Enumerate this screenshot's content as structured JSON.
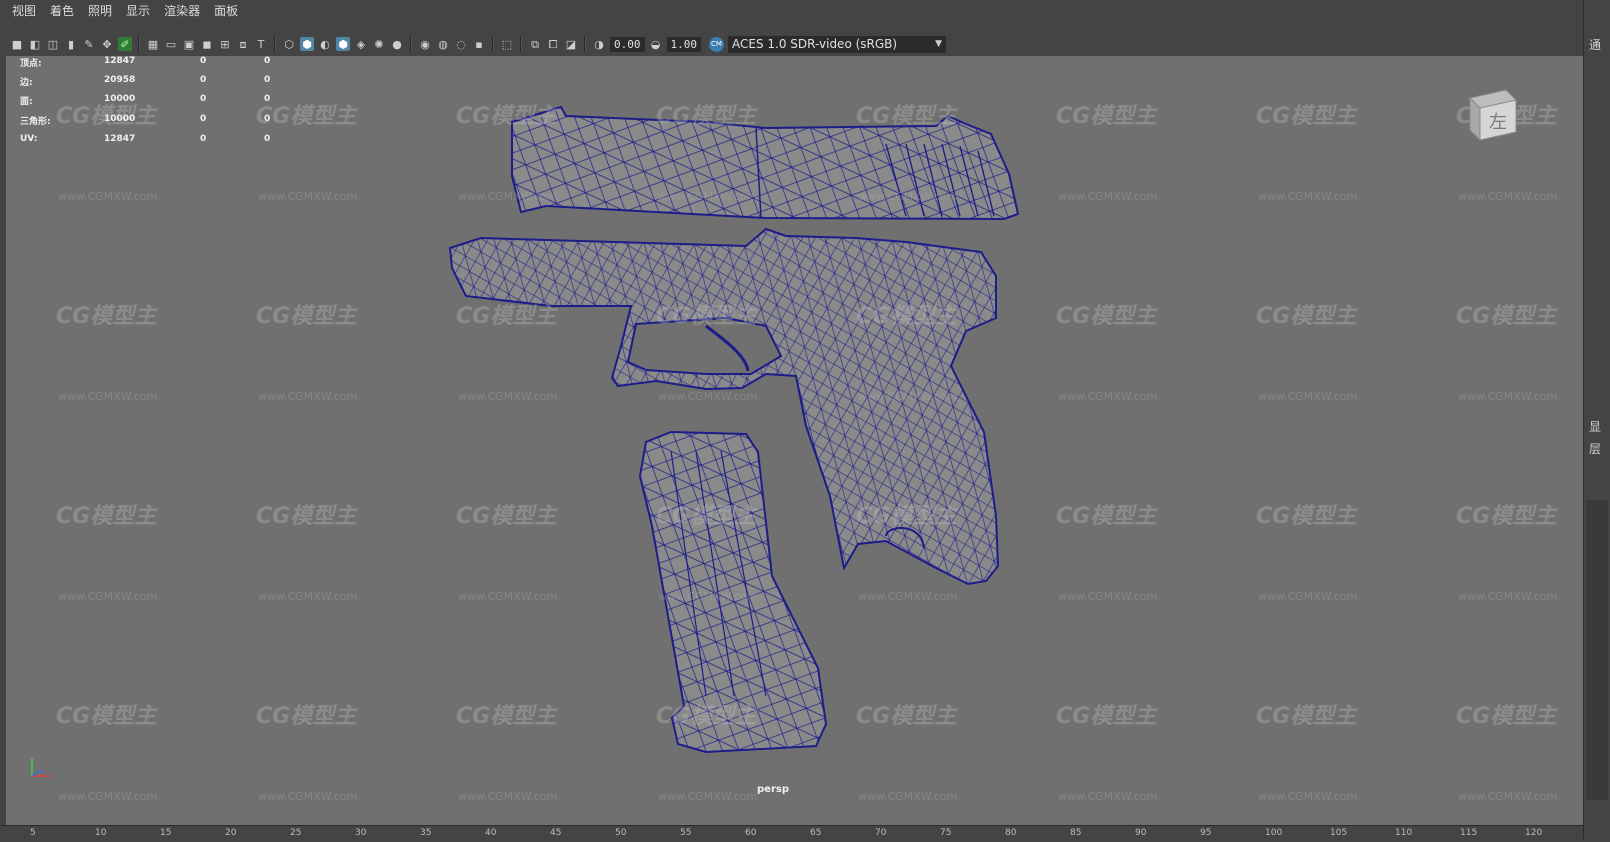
{
  "menu": {
    "items": [
      "视图",
      "着色",
      "照明",
      "显示",
      "渲染器",
      "面板"
    ]
  },
  "toolbar": {
    "exposure": "0.00",
    "gamma": "1.00",
    "color_space_badge": "CM",
    "color_space": "ACES 1.0 SDR-video (sRGB)"
  },
  "heads_up_display": {
    "rows": [
      {
        "label": "顶点:",
        "v1": "12847",
        "v2": "0",
        "v3": "0"
      },
      {
        "label": "边:",
        "v1": "20958",
        "v2": "0",
        "v3": "0"
      },
      {
        "label": "面:",
        "v1": "10000",
        "v2": "0",
        "v3": "0"
      },
      {
        "label": "三角形:",
        "v1": "10000",
        "v2": "0",
        "v3": "0"
      },
      {
        "label": "UV:",
        "v1": "12847",
        "v2": "0",
        "v3": "0"
      }
    ]
  },
  "viewport": {
    "camera": "persp",
    "viewcube_face": "左",
    "wireframe_color": "#1d1d8a",
    "mesh_color": "#8a8a8a",
    "background_color": "#707070"
  },
  "watermark": {
    "logo": "CG模型主",
    "url": "www.CGMXW.com"
  },
  "right_panel": {
    "glyphs": [
      "通",
      "显",
      "层"
    ]
  },
  "timeline": {
    "ticks": [
      "5",
      "10",
      "15",
      "20",
      "25",
      "30",
      "35",
      "40",
      "45",
      "50",
      "55",
      "60",
      "65",
      "70",
      "75",
      "80",
      "85",
      "90",
      "95",
      "100",
      "105",
      "110",
      "115",
      "120"
    ]
  }
}
